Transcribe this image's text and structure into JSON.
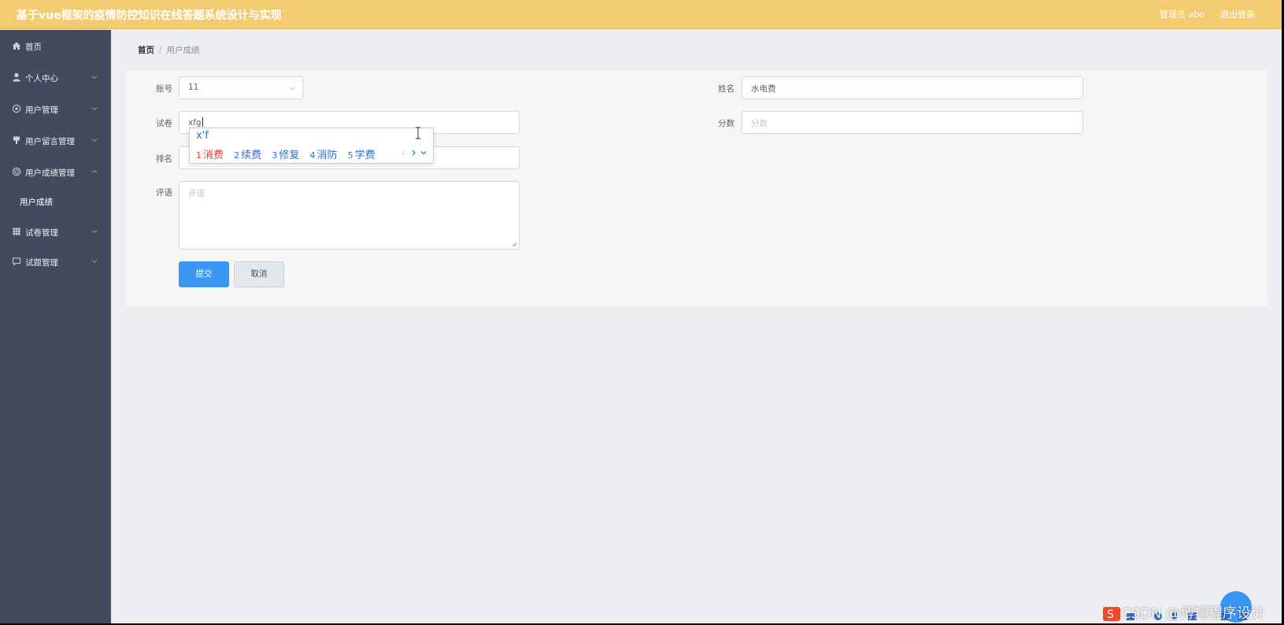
{
  "header": {
    "title": "基于vue框架的疫情防控知识在线答题系统设计与实现",
    "user_info": "管理员 abo",
    "logout": "退出登录"
  },
  "sidebar": {
    "items": [
      {
        "label": "首页",
        "icon": "home-icon"
      },
      {
        "label": "个人中心",
        "icon": "user-icon"
      },
      {
        "label": "用户管理",
        "icon": "users-icon"
      },
      {
        "label": "用户留言管理",
        "icon": "message-icon"
      },
      {
        "label": "用户成绩管理",
        "icon": "score-icon"
      },
      {
        "label": "试卷管理",
        "icon": "grid-icon"
      },
      {
        "label": "试题管理",
        "icon": "chat-icon"
      }
    ],
    "subitem": "用户成绩"
  },
  "breadcrumb": {
    "home": "首页",
    "separator": "/",
    "current": "用户成绩"
  },
  "form": {
    "account_label": "账号",
    "account_value": "11",
    "name_label": "姓名",
    "name_value": "水电费",
    "paper_label": "试卷",
    "paper_value": "xfg",
    "score_label": "分数",
    "score_placeholder": "分数",
    "rank_label": "排名",
    "comment_label": "评语",
    "comment_placeholder": "评语",
    "submit": "提交",
    "cancel": "取消"
  },
  "ime": {
    "composition": "x'f",
    "candidates": [
      {
        "n": "1",
        "text": "消费"
      },
      {
        "n": "2",
        "text": "续费"
      },
      {
        "n": "3",
        "text": "修复"
      },
      {
        "n": "4",
        "text": "消防"
      },
      {
        "n": "5",
        "text": "学费"
      }
    ]
  },
  "watermark": "CSDN @博翔程序设计",
  "colors": {
    "header_bg": "#f3cc72",
    "sidebar_bg": "#414b5d",
    "primary": "#3a97f4",
    "ime_selected": "#e2402f",
    "ime_text": "#2f6fd1"
  }
}
